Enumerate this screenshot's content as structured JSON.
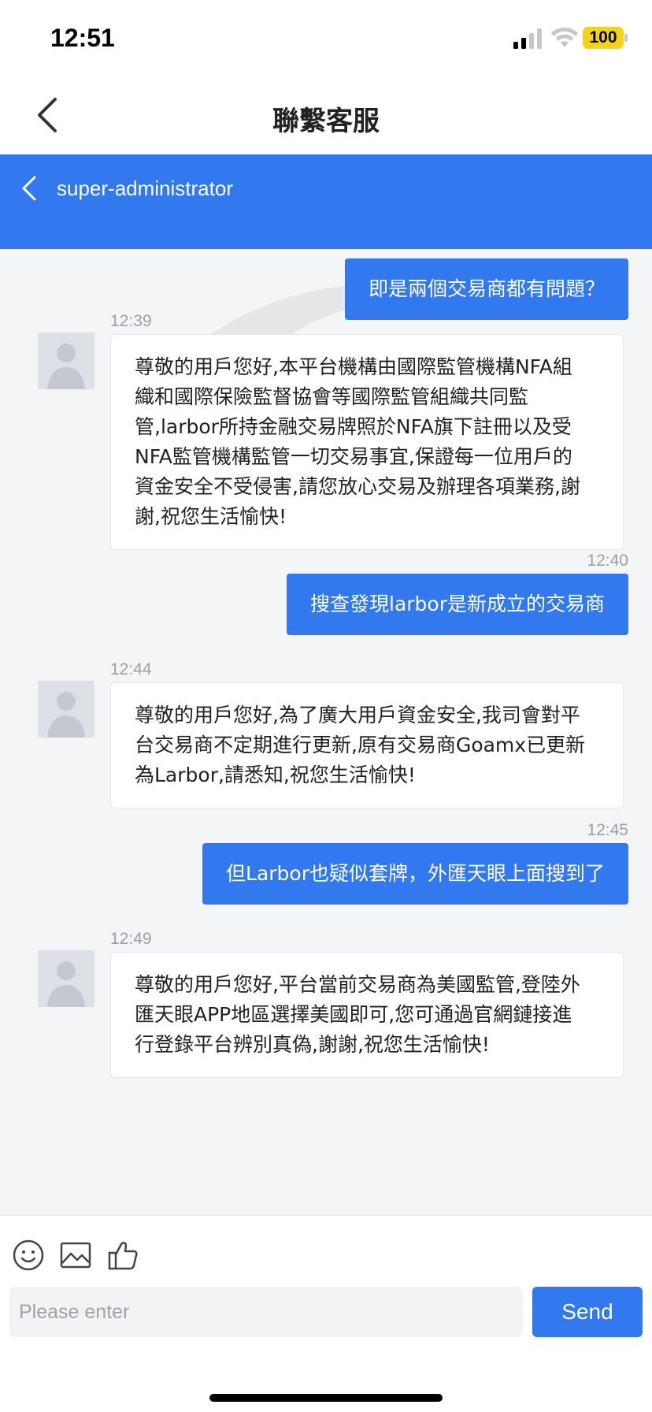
{
  "status": {
    "time": "12:51",
    "battery": "100"
  },
  "header": {
    "title": "聯繫客服"
  },
  "chat": {
    "username": "super-administrator"
  },
  "messages": {
    "out1": "即是兩個交易商都有問題？",
    "time_in1": "12:39",
    "in1_lines": [
      "尊敬的用戶您好,本平台機構由國際監管機構NFA組",
      "織和國際保險監督協會等國際監管組織共同監",
      "管,larbor所持金融交易牌照於NFA旗下註冊以及受",
      "NFA監管機構監管一切交易事宜,保證每一位用戶的",
      "資金安全不受侵害,請您放心交易及辦理各項業務,謝",
      "謝,祝您生活愉快!"
    ],
    "time_out2": "12:40",
    "out2": "搜查發現larbor是新成立的交易商",
    "time_in2": "12:44",
    "in2_lines": [
      "尊敬的用戶您好,為了廣大用戶資金安全,我司會對平",
      "台交易商不定期進行更新,原有交易商Goamx已更新",
      "為Larbor,請悉知,祝您生活愉快!"
    ],
    "time_out3": "12:45",
    "out3": "但Larbor也疑似套牌，外匯天眼上面搜到了",
    "time_in3": "12:49",
    "in3_lines": [
      "尊敬的用戶您好,平台當前交易商為美國監管,登陸外",
      "匯天眼APP地區選擇美國即可,您可通過官網鏈接進",
      "行登錄平台辨別真偽,謝謝,祝您生活愉快!"
    ]
  },
  "input": {
    "placeholder": "Please enter",
    "send_label": "Send"
  },
  "icons": [
    "emoji-icon",
    "image-icon",
    "thumbs-up-icon"
  ],
  "colors": {
    "accent": "#3278ee",
    "battery": "#f5d21a"
  }
}
